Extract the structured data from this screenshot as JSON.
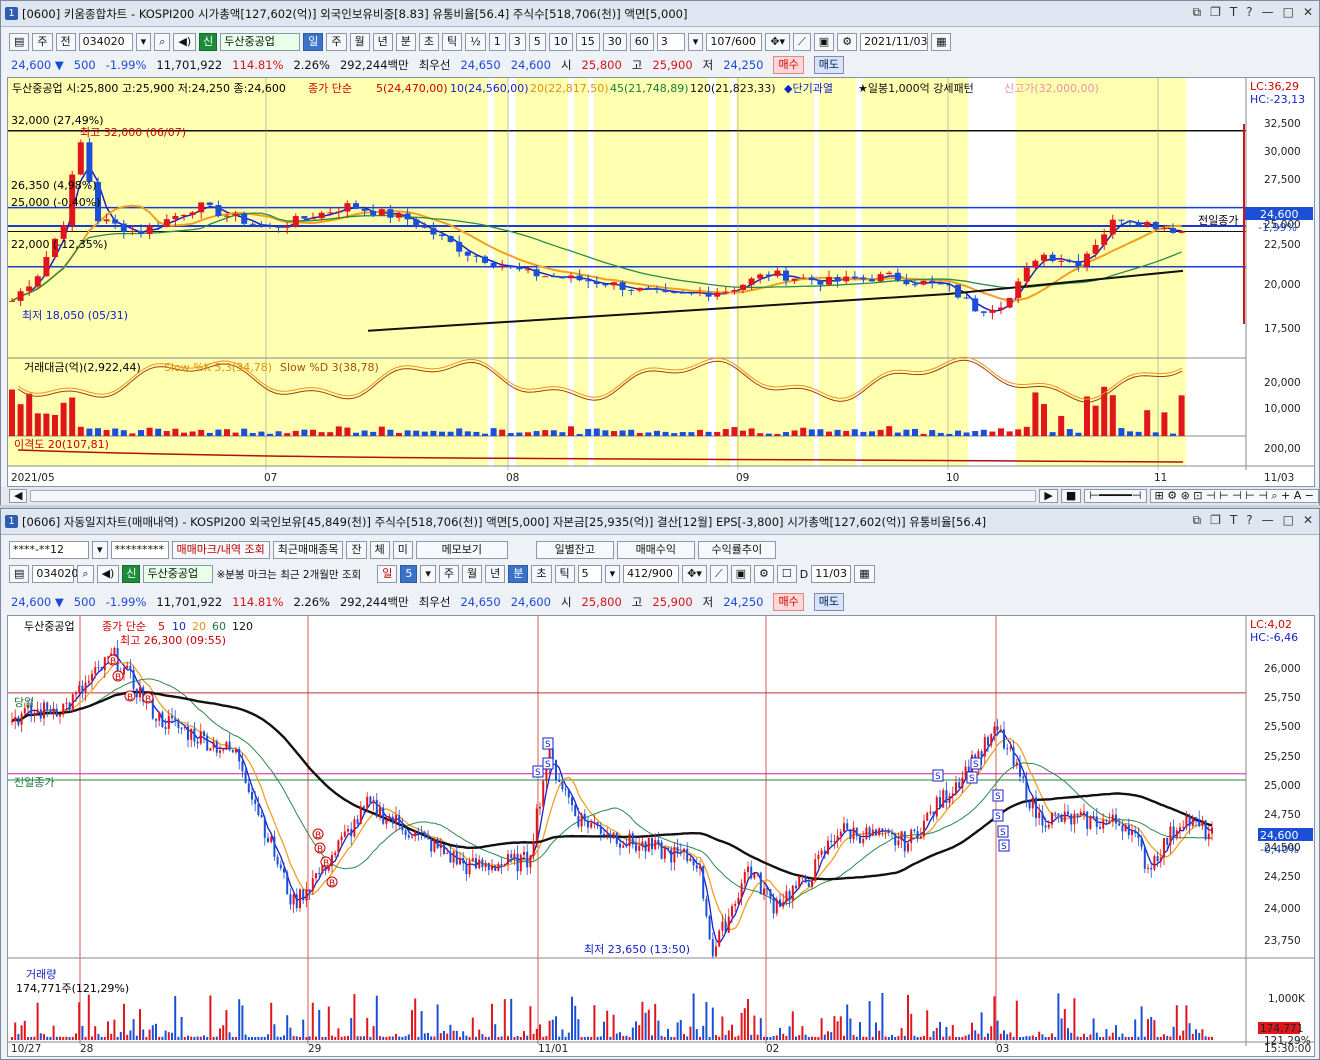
{
  "window1": {
    "number": "1",
    "title": "[0600] 키움종합차트 - KOSPI200 시가총액[127,602(억)] 외국인보유비중[8.83] 유통비율[56.4] 주식수[518,706(천)] 액면[5,000]",
    "toolbar": {
      "period_a": "주",
      "period_b": "전",
      "code": "034020",
      "badge": "신",
      "name": "두산중공업",
      "periods": [
        "일",
        "주",
        "월",
        "년",
        "분",
        "초",
        "틱"
      ],
      "frac": "½",
      "nums": [
        "1",
        "3",
        "5",
        "10",
        "15",
        "30",
        "60"
      ],
      "count": "3",
      "range": "107/600",
      "date": "2021/11/03"
    },
    "quote": {
      "price": "24,600",
      "arrow": "▼",
      "change": "500",
      "rate": "-1.99%",
      "volume": "11,701,922",
      "vol_ratio": "114.81%",
      "turnover": "2.26%",
      "amount": "292,244백만",
      "best": "최우선",
      "bid": "24,650",
      "ask": "24,600",
      "open_l": "시",
      "open": "25,800",
      "high_l": "고",
      "high": "25,900",
      "low_l": "저",
      "low": "24,250",
      "buy": "매수",
      "sell": "매도"
    },
    "legend": {
      "stock": "두산중공업 시:25,800 고:25,900 저:24,250 종:24,600",
      "ma_label": "종가 단순",
      "ma5": "5(24,470,00)",
      "ma10": "10(24,560,00)",
      "ma20": "20(22,817,50)",
      "ma45": "45(21,748,89)",
      "ma120": "120(21,823,33)",
      "tag1": "◆단기과열",
      "tag2": "★일봉1,000억 강세패턴",
      "tag3": "신고가(32,000,00)",
      "lc": "LC:36,29",
      "hc": "HC:-23,13"
    },
    "price_labels": {
      "l32000": "32,000 (27,49%)",
      "hi": "최고 32,000 (06/07)",
      "l26350": "26,350 (4,98%)",
      "l25000": "25,000 (-0,40%)",
      "l22000": "22,000 (-12,35%)",
      "lo": "최저 18,050 (05/31)",
      "cur": "24,600",
      "cur_pct": "-1,99%",
      "prevclose": "전일종가"
    },
    "yaxis": [
      "32,500",
      "30,000",
      "27,500",
      "25,000",
      "22,500",
      "20,000",
      "17,500"
    ],
    "volume_legend": {
      "name": "거래대금(억)(2,922,44)",
      "slowk": "Slow %K 5,3(34,78)",
      "slowd": "Slow %D 3(38,78)",
      "ticks": [
        "20,000",
        "10,000"
      ]
    },
    "disparity": {
      "name": "이격도 20(107,81)",
      "tick": "200,00"
    },
    "xaxis": [
      "2021/05",
      "07",
      "08",
      "09",
      "10",
      "11",
      "11/03"
    ],
    "colors": {
      "up": "#e0161c",
      "down": "#1b4fd8",
      "highlight": "#ffffb0",
      "ma5": "#1422c8",
      "ma20": "#f0a020",
      "ma60": "#2a8a4a",
      "ma120": "#111111"
    }
  },
  "window2": {
    "number": "1",
    "title": "[0606] 자동일지차트(매매내역) - KOSPI200 외국인보유[45,849(천)] 주식수[518,706(천)] 액면[5,000] 자본금[25,935(억)] 결산[12월] EPS[-3,800] 시가총액[127,602(억)] 유통비율[56.4]",
    "row1": {
      "account": "****-**12",
      "password": "*********",
      "b1": "매매마크/내역 조회",
      "b2": "최근매매종목",
      "b3": "잔",
      "b4": "체",
      "b5": "미",
      "b6": "메모보기",
      "b7": "일별잔고",
      "b8": "매매수익",
      "b9": "수익률추이"
    },
    "row2": {
      "code": "034020",
      "badge": "신",
      "name": "두산중공업",
      "note": "※분봉 마크는 최근 2개월만 조회",
      "p_day": "일",
      "p_num": "5",
      "periods": [
        "주",
        "월",
        "년",
        "분",
        "초",
        "틱"
      ],
      "n": "5",
      "range": "412/900",
      "chk": "D",
      "date": "11/03"
    },
    "quote": {
      "price": "24,600",
      "arrow": "▼",
      "change": "500",
      "rate": "-1.99%",
      "volume": "11,701,922",
      "vol_ratio": "114.81%",
      "turnover": "2.26%",
      "amount": "292,244백만",
      "best": "최우선",
      "bid": "24,650",
      "ask": "24,600",
      "open_l": "시",
      "open": "25,800",
      "high_l": "고",
      "high": "25,900",
      "low_l": "저",
      "low": "24,250",
      "buy": "매수",
      "sell": "매도"
    },
    "legend": {
      "stock": "두산중공업",
      "ma_label": "종가 단순",
      "ma5": "5",
      "ma10": "10",
      "ma20": "20",
      "ma60": "60",
      "ma120": "120",
      "lc": "LC:4,02",
      "hc": "HC:-6,46"
    },
    "labels": {
      "hi": "최고 26,300 (09:55)",
      "lo": "최저 23,650 (13:50)",
      "prevclose": "전일종가",
      "yest": "당일",
      "cur": "24,600",
      "cur_pct": "-0,40%"
    },
    "yaxis": [
      "26,000",
      "25,750",
      "25,500",
      "25,250",
      "25,000",
      "24,750",
      "24,500",
      "24,250",
      "24,000",
      "23,750"
    ],
    "volume": {
      "name": "거래량",
      "value": "174,771주(121,29%)",
      "tick": "1,000K",
      "cur": "174,771",
      "cur_pct": "121,29%"
    },
    "xaxis": [
      "10/27",
      "28",
      "29",
      "11/01",
      "02",
      "03",
      "15:30:00"
    ],
    "marks": {
      "buy": "B",
      "sell": "S"
    }
  }
}
